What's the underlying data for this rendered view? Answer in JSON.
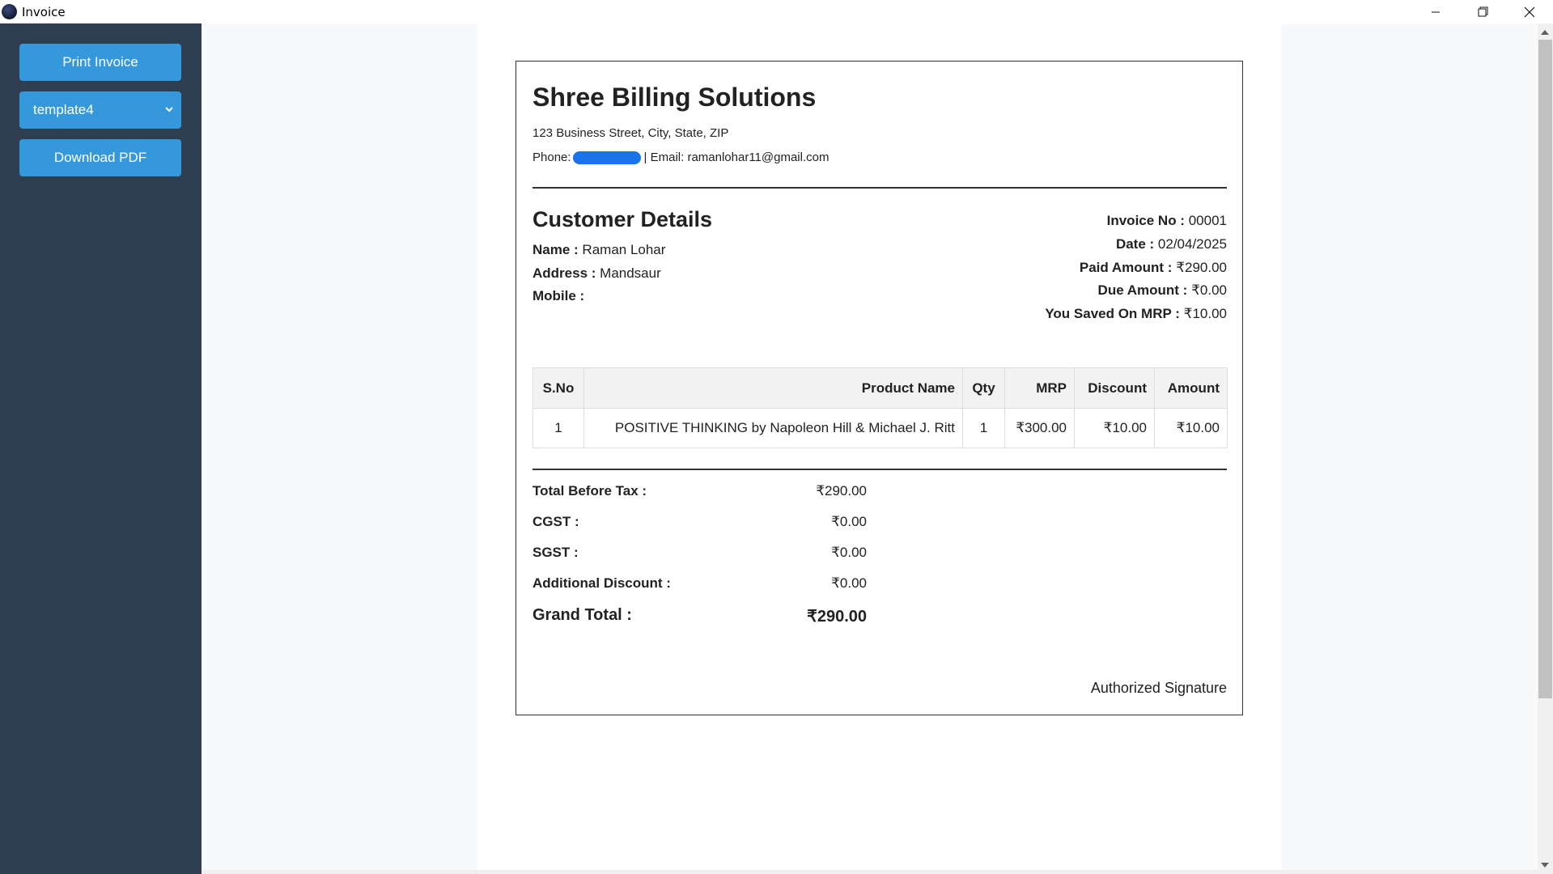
{
  "window": {
    "title": "Invoice",
    "controls": {
      "minimize": "—",
      "maximize": "❐",
      "close": "✕"
    }
  },
  "sidebar": {
    "print_label": "Print Invoice",
    "template_selected": "template4",
    "download_label": "Download PDF"
  },
  "invoice": {
    "company": "Shree Billing Solutions",
    "address": "123 Business Street, City, State, ZIP",
    "phone_label": "Phone:",
    "email_text": "| Email: ramanlohar11@gmail.com",
    "customer_title": "Customer Details",
    "customer": {
      "name_label": "Name :",
      "name": "Raman Lohar",
      "address_label": "Address :",
      "address": "Mandsaur",
      "mobile_label": "Mobile :",
      "mobile": ""
    },
    "meta": {
      "invoice_no_label": "Invoice No :",
      "invoice_no": "00001",
      "date_label": "Date :",
      "date": "02/04/2025",
      "paid_label": "Paid Amount :",
      "paid": "₹290.00",
      "due_label": "Due Amount :",
      "due": "₹0.00",
      "saved_label": "You Saved On MRP :",
      "saved": "₹10.00"
    },
    "table": {
      "headers": [
        "S.No",
        "Product Name",
        "Qty",
        "MRP",
        "Discount",
        "Amount"
      ],
      "rows": [
        [
          "1",
          "POSITIVE THINKING by Napoleon Hill & Michael J. Ritt",
          "1",
          "₹300.00",
          "₹10.00",
          "₹10.00"
        ]
      ]
    },
    "totals": {
      "before_tax_label": "Total Before Tax :",
      "before_tax": "₹290.00",
      "cgst_label": "CGST :",
      "cgst": "₹0.00",
      "sgst_label": "SGST :",
      "sgst": "₹0.00",
      "add_disc_label": "Additional Discount :",
      "add_disc": "₹0.00",
      "grand_label": "Grand Total :",
      "grand": "₹290.00"
    },
    "signature": "Authorized Signature"
  },
  "colors": {
    "sidebar": "#2c3e50",
    "button": "#3498db",
    "redaction": "#1a73e8"
  }
}
